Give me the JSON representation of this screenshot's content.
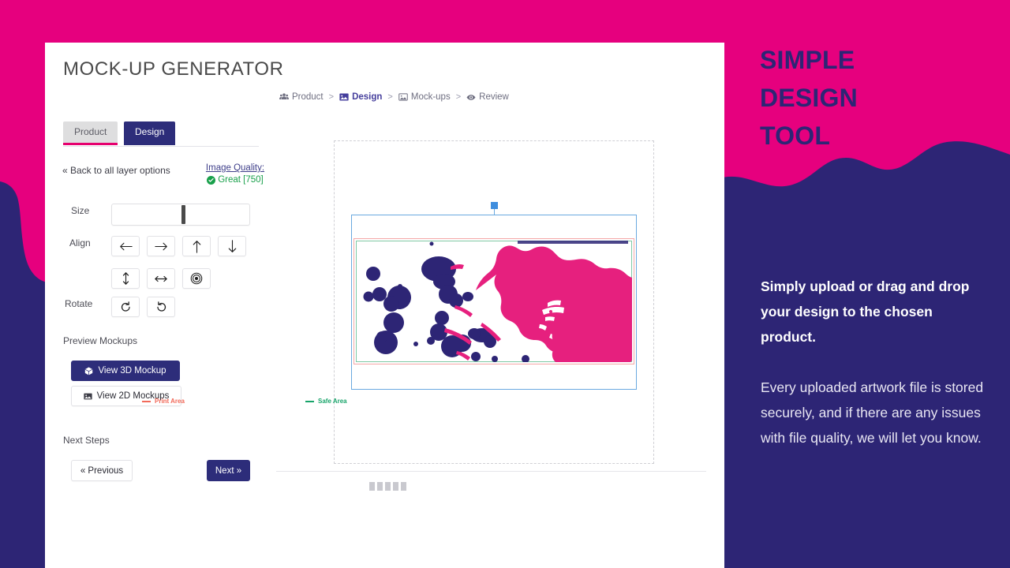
{
  "colors": {
    "pink": "#e6007e",
    "navy": "#2d2575",
    "tab_active_bg": "#2d2d7a",
    "accent_underline": "#e6006e",
    "quality_green": "#19a04b",
    "print_area": "#f26a5a",
    "safe_area": "#18a46a",
    "selection": "#6aa9e0",
    "artwork_navy": "#2d2575",
    "artwork_pink": "#e6207e"
  },
  "app": {
    "title": "MOCK-UP GENERATOR"
  },
  "breadcrumb": {
    "items": [
      {
        "label": "Product",
        "icon": "people-icon",
        "active": false
      },
      {
        "label": "Design",
        "icon": "image-icon",
        "active": true
      },
      {
        "label": "Mock-ups",
        "icon": "picture-icon",
        "active": false
      },
      {
        "label": "Review",
        "icon": "eye-icon",
        "active": false
      }
    ],
    "separator": ">"
  },
  "tabs": {
    "product_label": "Product",
    "design_label": "Design"
  },
  "layer_panel": {
    "back_link": "« Back to all layer options",
    "quality_title": "Image Quality:",
    "quality_value": "Great [750]",
    "quality_icon": "check-circle-icon"
  },
  "controls": {
    "size_label": "Size",
    "size_handle_percent": 52,
    "align_label": "Align",
    "rotate_label": "Rotate",
    "align_buttons": [
      {
        "name": "align-left-button",
        "icon": "arrow-left-icon",
        "glyph": "←"
      },
      {
        "name": "align-right-button",
        "icon": "arrow-right-icon",
        "glyph": "→"
      },
      {
        "name": "align-top-button",
        "icon": "arrow-up-icon",
        "glyph": "↑"
      },
      {
        "name": "align-bottom-button",
        "icon": "arrow-down-icon",
        "glyph": "↓"
      }
    ],
    "align_buttons_row2": [
      {
        "name": "stretch-vertical-button",
        "icon": "arrow-up-down-icon",
        "glyph": "↕"
      },
      {
        "name": "stretch-horizontal-button",
        "icon": "arrow-left-right-icon",
        "glyph": "↔"
      },
      {
        "name": "center-button",
        "icon": "target-icon",
        "glyph": "◎"
      }
    ],
    "rotate_buttons": [
      {
        "name": "rotate-clockwise-button",
        "icon": "rotate-cw-icon",
        "glyph": "↻"
      },
      {
        "name": "rotate-counterclockwise-button",
        "icon": "rotate-ccw-icon",
        "glyph": "↺"
      }
    ]
  },
  "preview": {
    "section_title": "Preview Mockups",
    "view_3d_label": "View 3D Mockup",
    "view_3d_icon": "cube-icon",
    "view_2d_label": "View 2D Mockups",
    "view_2d_icon": "image-icon"
  },
  "next_steps": {
    "section_title": "Next Steps",
    "previous_label": "« Previous",
    "next_label": "Next »"
  },
  "canvas": {
    "legend_print": "Print Area",
    "legend_safe": "Safe Area",
    "page_dots": 5
  },
  "marketing": {
    "heading_lines": [
      "SIMPLE",
      "DESIGN",
      "TOOL"
    ],
    "heading_text": "SIMPLE DESIGN TOOL",
    "body_bold": "Simply upload or drag and drop your design to the chosen product.",
    "body": "Every uploaded artwork file is stored securely, and if there are any issues with file quality, we will let you know."
  }
}
